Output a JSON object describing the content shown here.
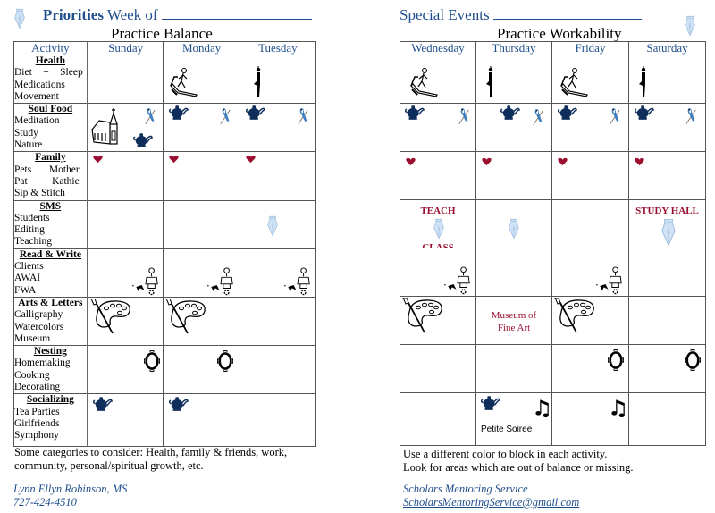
{
  "left_page": {
    "header": {
      "bold": "Priorities",
      "rest": " Week of"
    },
    "subtitle": "Practice Balance",
    "columns": [
      "Activity",
      "Sunday",
      "Monday",
      "Tuesday"
    ],
    "activities": [
      {
        "category": "Health",
        "lines": [
          "Diet + Sleep",
          "Medications",
          "Movement"
        ],
        "spread": [
          [
            "Diet",
            "+",
            "Sleep"
          ]
        ]
      },
      {
        "category": "Soul Food",
        "lines": [
          "Meditation",
          "Study",
          "Nature"
        ]
      },
      {
        "category": "Family",
        "lines": [
          "Pets Mother",
          "Pat Kathie",
          "Sip & Stitch"
        ],
        "spread": [
          [
            "Pets",
            "Mother"
          ],
          [
            "Pat",
            "Kathie"
          ]
        ]
      },
      {
        "category": "SMS",
        "lines": [
          "Students",
          "Editing",
          "Teaching"
        ]
      },
      {
        "category": "Read & Write",
        "lines": [
          "Clients",
          "AWAI",
          "FWA"
        ]
      },
      {
        "category": "Arts & Letters",
        "lines": [
          "Calligraphy",
          "Watercolors",
          "Museum"
        ]
      },
      {
        "category": "Nesting",
        "lines": [
          "Homemaking",
          "Cooking",
          "Decorating"
        ]
      },
      {
        "category": "Socializing",
        "lines": [
          "Tea Parties",
          "Girlfriends",
          "Symphony"
        ]
      }
    ],
    "cells": {
      "health": {
        "Sunday": [],
        "Monday": [
          "treadmill-icon"
        ],
        "Tuesday": [
          "yoga-pose-icon"
        ]
      },
      "soul_food": {
        "Sunday": [
          "church-icon",
          "bluejay-icon",
          "teapot-icon"
        ],
        "Monday": [
          "teapot-icon",
          "bluejay-icon"
        ],
        "Tuesday": [
          "teapot-icon",
          "bluejay-icon"
        ]
      },
      "family": {
        "Sunday": [
          "heart-icon"
        ],
        "Monday": [
          "heart-icon"
        ],
        "Tuesday": [
          "heart-icon"
        ]
      },
      "sms": {
        "Sunday": [],
        "Monday": [],
        "Tuesday": [
          "pen-nib-icon"
        ]
      },
      "read_write": {
        "Sunday": [
          "writing-desk-icon"
        ],
        "Monday": [
          "writing-desk-icon"
        ],
        "Tuesday": [
          "writing-desk-icon"
        ]
      },
      "arts": {
        "Sunday": [
          "paint-palette-icon"
        ],
        "Monday": [
          "paint-palette-icon"
        ],
        "Tuesday": []
      },
      "nesting": {
        "Sunday": [
          "ornate-mirror-icon"
        ],
        "Monday": [
          "ornate-mirror-icon"
        ],
        "Tuesday": []
      },
      "socializing": {
        "Sunday": [
          "teapot-icon"
        ],
        "Monday": [
          "teapot-icon"
        ],
        "Tuesday": []
      }
    },
    "note": "Some categories to consider: Health, family & friends, work, community, personal/spiritual growth, etc.",
    "signature": {
      "name": "Lynn Ellyn Robinson, MS",
      "phone": "727-424-4510"
    }
  },
  "right_page": {
    "header": "Special Events",
    "subtitle": "Practice Workability",
    "columns": [
      "Wednesday",
      "Thursday",
      "Friday",
      "Saturday"
    ],
    "cell_text": {
      "teach": "TEACH",
      "class": "CLASS",
      "study_hall": "STUDY HALL",
      "museum_line1": "Museum of",
      "museum_line2": "Fine Art",
      "petite_soiree": "Petite Soiree"
    },
    "note_lines": [
      "Use a different color to block in each activity.",
      "Look for areas which are out of balance or missing."
    ],
    "signature": {
      "name": "Scholars Mentoring Service",
      "email": "ScholarsMentoringService@gmail.com"
    }
  },
  "colors": {
    "heading_blue": "#1f4e8c",
    "accent_red": "#9b1030",
    "teapot_navy": "#0f2e5c",
    "nib_light_blue": "#a8c8e8"
  }
}
